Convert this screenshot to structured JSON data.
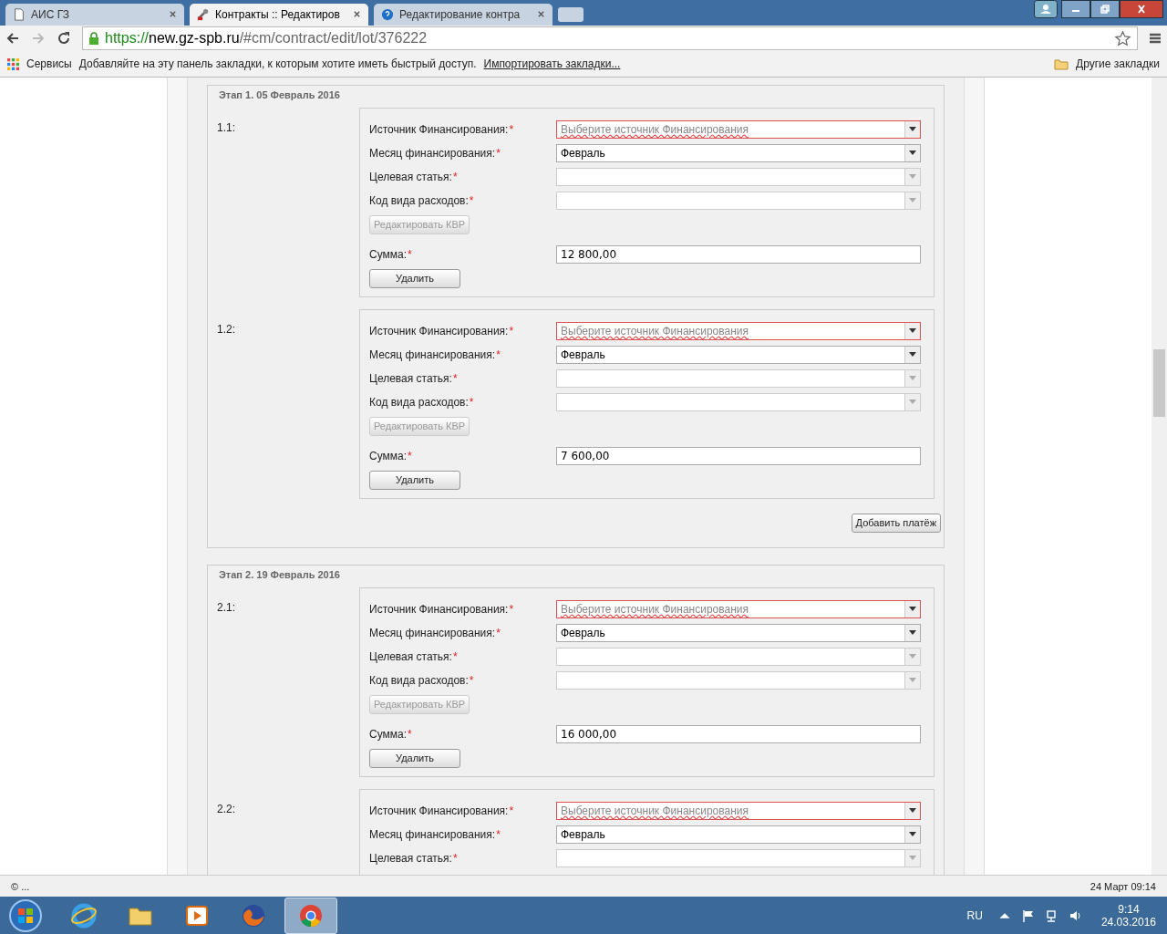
{
  "browser": {
    "tabs": [
      {
        "title": "АИС ГЗ",
        "selected": false
      },
      {
        "title": "Контракты :: Редактиров",
        "selected": true
      },
      {
        "title": "Редактирование контра",
        "selected": false
      }
    ],
    "address": {
      "scheme": "https://",
      "host": "new.gz-spb.ru",
      "path": "/#cm/contract/edit/lot/376222"
    },
    "bookmarks": {
      "apps": "Сервисы",
      "hint": "Добавляйте на эту панель закладки, к которым хотите иметь быстрый доступ.",
      "import_link": "Импортировать закладки...",
      "other": "Другие закладки"
    }
  },
  "stages": [
    {
      "legend": "Этап 1. 05 Февраль 2016",
      "add_button": "Добавить платёж",
      "payments": [
        {
          "label": "1.1:",
          "fields": [
            {
              "kind": "select",
              "label": "Источник Финансирования:",
              "mark": "*",
              "placeholder": "Выберите источник Финансирования",
              "invalid": true,
              "disabled": false
            },
            {
              "kind": "select",
              "label": "Месяц финансирования:",
              "mark": "*",
              "value": "Февраль",
              "invalid": false,
              "disabled": false
            },
            {
              "kind": "select",
              "label": "Целевая статья:",
              "mark": "*",
              "invalid": false,
              "disabled": true
            },
            {
              "kind": "select",
              "label": "Код вида расходов:",
              "mark": "*",
              "invalid": false,
              "disabled": true
            },
            {
              "kind": "button",
              "label": "Редактировать КВР",
              "disabled": true
            },
            {
              "kind": "input",
              "label": "Сумма:",
              "mark": "*",
              "value": "12 800,00"
            }
          ],
          "delete_button": "Удалить"
        },
        {
          "label": "1.2:",
          "fields": [
            {
              "kind": "select",
              "label": "Источник Финансирования:",
              "mark": "*",
              "placeholder": "Выберите источник Финансирования",
              "invalid": true,
              "disabled": false
            },
            {
              "kind": "select",
              "label": "Месяц финансирования:",
              "mark": "*",
              "value": "Февраль",
              "invalid": false,
              "disabled": false
            },
            {
              "kind": "select",
              "label": "Целевая статья:",
              "mark": "*",
              "invalid": false,
              "disabled": true
            },
            {
              "kind": "select",
              "label": "Код вида расходов:",
              "mark": "*",
              "invalid": false,
              "disabled": true
            },
            {
              "kind": "button",
              "label": "Редактировать КВР",
              "disabled": true
            },
            {
              "kind": "input",
              "label": "Сумма:",
              "mark": "*",
              "value": "7 600,00"
            }
          ],
          "delete_button": "Удалить"
        }
      ]
    },
    {
      "legend": "Этап 2. 19 Февраль 2016",
      "payments": [
        {
          "label": "2.1:",
          "fields": [
            {
              "kind": "select",
              "label": "Источник Финансирования:",
              "mark": "*",
              "placeholder": "Выберите источник Финансирования",
              "invalid": true,
              "disabled": false
            },
            {
              "kind": "select",
              "label": "Месяц финансирования:",
              "mark": "*",
              "value": "Февраль",
              "invalid": false,
              "disabled": false
            },
            {
              "kind": "select",
              "label": "Целевая статья:",
              "mark": "*",
              "invalid": false,
              "disabled": true
            },
            {
              "kind": "select",
              "label": "Код вида расходов:",
              "mark": "*",
              "invalid": false,
              "disabled": true
            },
            {
              "kind": "button",
              "label": "Редактировать КВР",
              "disabled": true
            },
            {
              "kind": "input",
              "label": "Сумма:",
              "mark": "*",
              "value": "16 000,00"
            }
          ],
          "delete_button": "Удалить"
        },
        {
          "label": "2.2:",
          "fields": [
            {
              "kind": "select",
              "label": "Источник Финансирования:",
              "mark": "*",
              "placeholder": "Выберите источник Финансирования",
              "invalid": true,
              "disabled": false
            },
            {
              "kind": "select",
              "label": "Месяц финансирования:",
              "mark": "*",
              "value": "Февраль",
              "invalid": false,
              "disabled": false
            },
            {
              "kind": "select",
              "label": "Целевая статья:",
              "mark": "*",
              "invalid": false,
              "disabled": true
            }
          ]
        }
      ]
    }
  ],
  "status_bar": {
    "left": "© ...",
    "right": "24 Март 09:14"
  },
  "taskbar": {
    "apps": [
      {
        "selected": false
      },
      {
        "selected": false
      },
      {
        "selected": false
      },
      {
        "selected": false
      },
      {
        "selected": true
      }
    ],
    "language": "RU",
    "time": "9:14",
    "date": "24.03.2016"
  }
}
